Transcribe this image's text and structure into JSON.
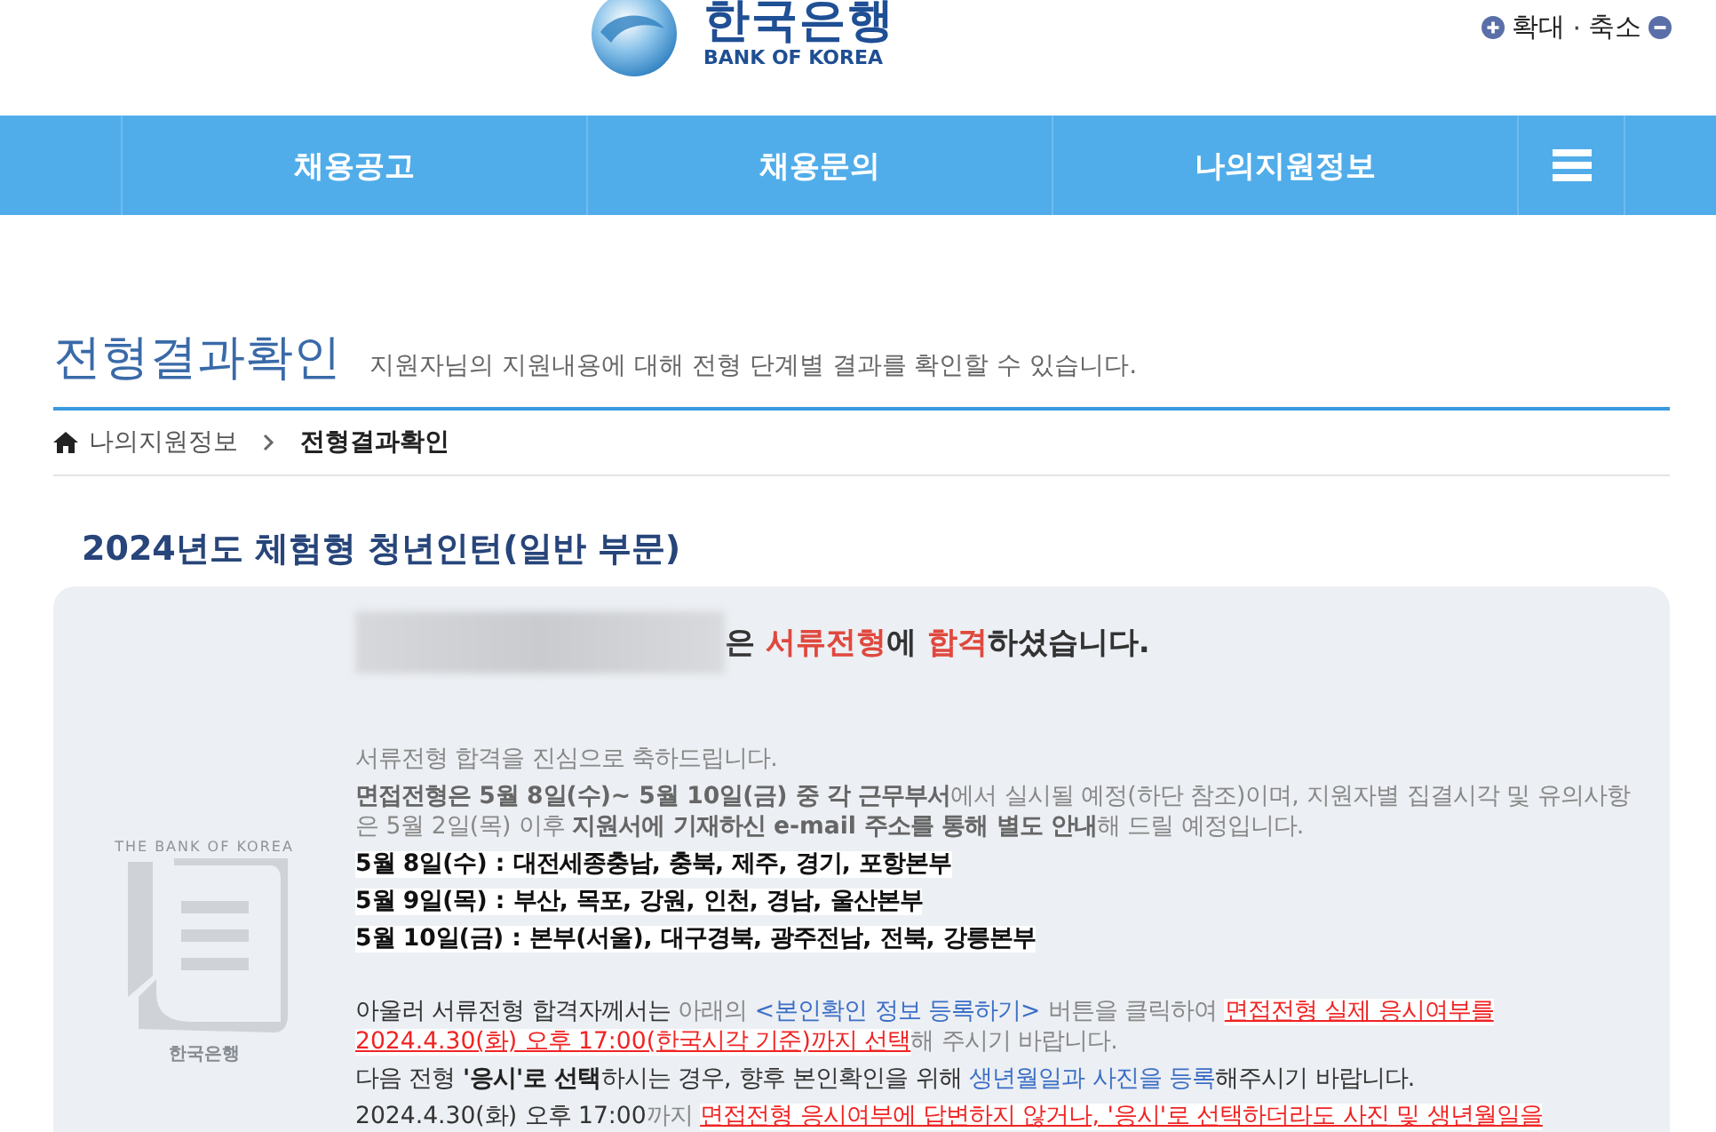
{
  "header": {
    "logo_korean": "한국은행",
    "logo_english": "BANK OF KOREA",
    "zoom_in": "확대",
    "separator": "·",
    "zoom_out": "축소"
  },
  "nav": {
    "items": [
      "채용공고",
      "채용문의",
      "나의지원정보"
    ]
  },
  "page": {
    "title": "전형결과확인",
    "subtitle": "지원자님의 지원내용에 대해 전형 단계별 결과를 확인할 수 있습니다."
  },
  "breadcrumb": [
    {
      "label": "나의지원정보",
      "current": false
    },
    {
      "label": "전형결과확인",
      "current": true
    }
  ],
  "section_title": "2024년도 체험형 청년인턴(일반 부문)",
  "result": {
    "watermark_english": "THE BANK OF KOREA",
    "watermark_korean": "한국은행",
    "headline": [
      {
        "kind": "dark",
        "text": "은 "
      },
      {
        "kind": "red",
        "text": "서류전형"
      },
      {
        "kind": "dark",
        "text": "에 "
      },
      {
        "kind": "red",
        "text": "합격"
      },
      {
        "kind": "dark",
        "text": "하셨습니다."
      }
    ],
    "paragraphs": [
      [
        {
          "kind": "gray",
          "text": "서류전형 합격을 진심으로 축하드립니다."
        }
      ],
      [
        {
          "kind": "boldgray",
          "text": "면접전형은 5월 8일(수)~ 5월 10일(금) 중 각 근무부서"
        },
        {
          "kind": "gray",
          "text": "에서 실시될 예정(하단 참조)이며, 지원자별 집결시각 및 유의사항은 5월 2일(목) 이후 "
        },
        {
          "kind": "boldgray",
          "text": "지원서에 기재하신 e-mail 주소를 통해 별도 안내"
        },
        {
          "kind": "gray",
          "text": "해 드릴 예정입니다."
        }
      ],
      [
        {
          "kind": "highlight",
          "text": "5월 8일(수) : 대전세종충남, 충북, 제주, 경기, 포항본부"
        }
      ],
      [
        {
          "kind": "highlight",
          "text": "5월 9일(목) :  부산, 목포, 강원, 인천, 경남, 울산본부"
        }
      ],
      [
        {
          "kind": "highlight",
          "text": "5월 10일(금) :  본부(서울), 대구경북, 광주전남, 전북, 강릉본부"
        }
      ],
      [
        {
          "kind": "gap"
        }
      ],
      [
        {
          "kind": "dark",
          "text": "아울러 서류전형 합격자께서는 "
        },
        {
          "kind": "gray",
          "text": "아래의 "
        },
        {
          "kind": "blue",
          "text": "<본인확인 정보 등록하기>"
        },
        {
          "kind": "gray",
          "text": " 버튼을 클릭하여 "
        },
        {
          "kind": "redline",
          "text": "면접전형 실제 응시여부를 2024.4.30(화) 오후 17:00(한국시각 기준)까지 선택"
        },
        {
          "kind": "gray",
          "text": "해 주시기 바랍니다."
        }
      ],
      [
        {
          "kind": "dark",
          "text": "다음 전형 "
        },
        {
          "kind": "bold",
          "text": "'응시'로 선택"
        },
        {
          "kind": "dark",
          "text": "하시는 경우, 향후 본인확인을 위해 "
        },
        {
          "kind": "blue",
          "text": "생년월일과 사진을 등록"
        },
        {
          "kind": "dark",
          "text": "해주시기 바랍니다."
        }
      ],
      [
        {
          "kind": "dark",
          "text": "2024.4.30(화) 오후 17:00"
        },
        {
          "kind": "gray",
          "text": "까지 "
        },
        {
          "kind": "redline",
          "text": "면접전형 응시여부에 답변하지 않거나, '응시'로 선택하더라도 사진 및 생년월일을"
        }
      ]
    ]
  }
}
